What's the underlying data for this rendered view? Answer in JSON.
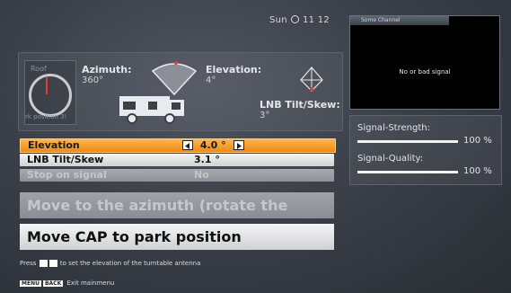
{
  "clock": {
    "day": "Sun",
    "time": "11 12"
  },
  "status": {
    "dial_roof_label": "Roof",
    "dial_park_label": "rk position 3!",
    "azimuth_label": "Azimuth:",
    "azimuth_value": "360°",
    "elevation_label": "Elevation:",
    "elevation_value": "4°",
    "lnb_label": "LNB Tilt/Skew:",
    "lnb_value": "3°"
  },
  "menu": {
    "rows": [
      {
        "label": "Elevation",
        "value": "4.0 °"
      },
      {
        "label": "LNB Tilt/Skew",
        "value": "3.1 °"
      },
      {
        "label": "Stop on signal",
        "value": "No"
      }
    ],
    "button_azimuth": "Move to the azimuth (rotate the anten...",
    "button_park": "Move CAP to park position"
  },
  "hint": {
    "pre": "Press",
    "post": "to set the elevation of the turntable antenna"
  },
  "footer": {
    "menu_key": "MENU",
    "back_key": "BACK",
    "label": "Exit mainmenu"
  },
  "video": {
    "channel": "Some Channel",
    "message": "No or bad signal"
  },
  "signal": {
    "strength_label": "Signal-Strength:",
    "strength_value": "100 %",
    "strength_level": 100,
    "quality_label": "Signal-Quality:",
    "quality_value": "100 %",
    "quality_level": 100
  },
  "colors": {
    "selection": "#f08a14",
    "needle": "#e03b3b"
  }
}
